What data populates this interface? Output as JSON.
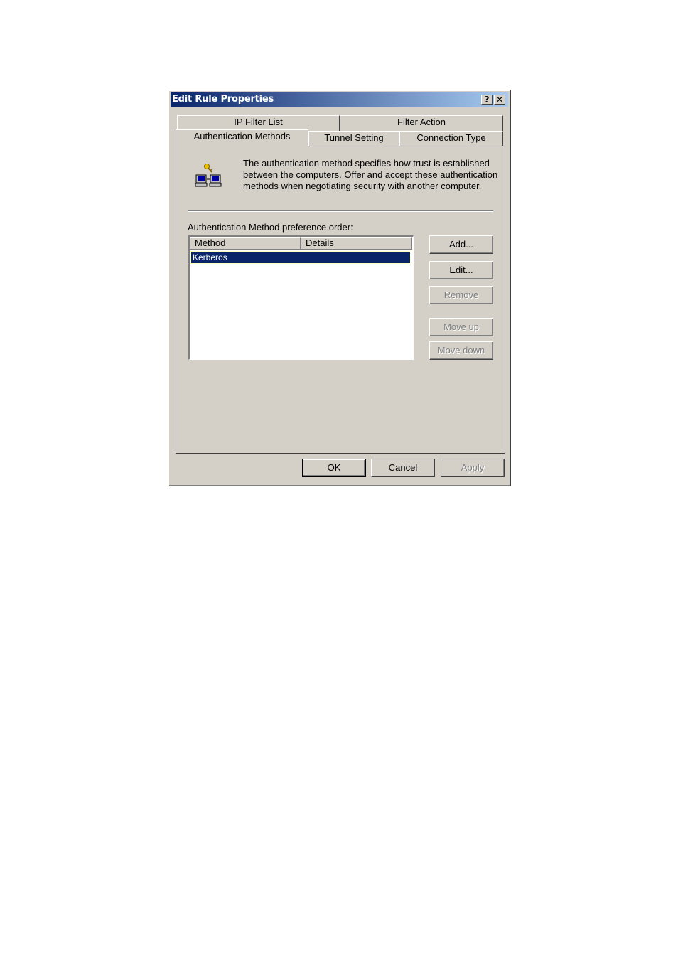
{
  "window": {
    "title": "Edit Rule Properties",
    "help_label": "?",
    "close_label": "✕"
  },
  "tabs": {
    "back_row": [
      "IP Filter List",
      "Filter Action"
    ],
    "front_row": [
      "Authentication Methods",
      "Tunnel Setting",
      "Connection Type"
    ],
    "active": "Authentication Methods"
  },
  "panel": {
    "description": "The authentication method specifies how trust is established between the computers. Offer and accept these authentication methods when negotiating security with another computer.",
    "list_label": "Authentication Method preference order:",
    "columns": [
      "Method",
      "Details"
    ],
    "rows": [
      {
        "method": "Kerberos",
        "details": "",
        "selected": true
      }
    ],
    "buttons": {
      "add": "Add...",
      "edit": "Edit...",
      "remove": "Remove",
      "move_up": "Move up",
      "move_down": "Move down"
    }
  },
  "footer": {
    "ok": "OK",
    "cancel": "Cancel",
    "apply": "Apply"
  },
  "colors": {
    "title_gradient_start": "#0a246a",
    "title_gradient_end": "#a6caf0",
    "face": "#d4d0c8",
    "selection": "#0a246a"
  },
  "icons": [
    "key-network-icon"
  ]
}
